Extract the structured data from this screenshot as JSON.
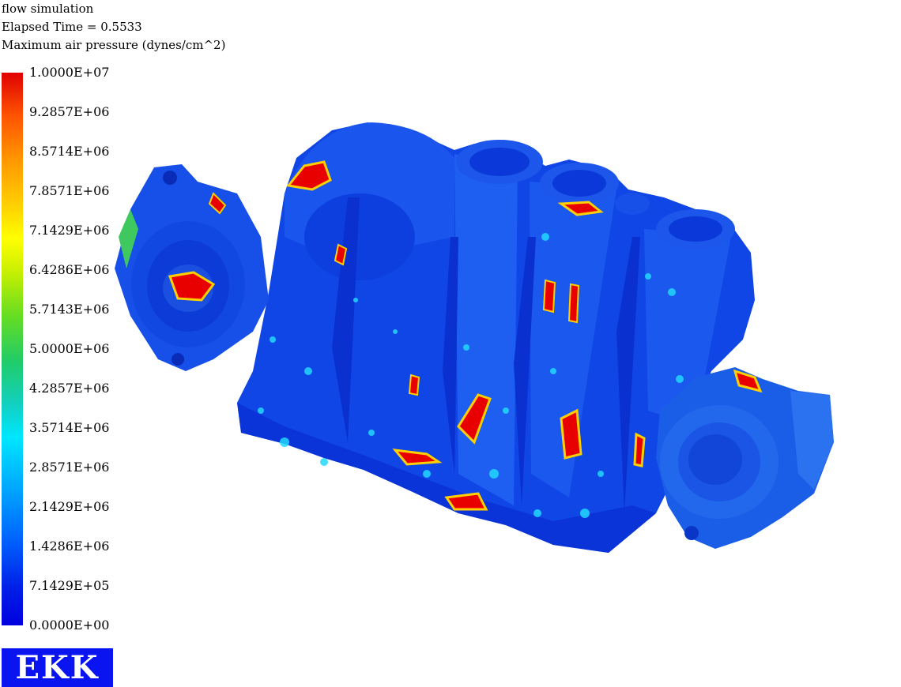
{
  "header": {
    "title": "flow simulation",
    "elapsed": "Elapsed Time = 0.5533",
    "quantity": "Maximum air pressure (dynes/cm^2)"
  },
  "legend": {
    "ticks": [
      "1.0000E+07",
      "9.2857E+06",
      "8.5714E+06",
      "7.8571E+06",
      "7.1429E+06",
      "6.4286E+06",
      "5.7143E+06",
      "5.0000E+06",
      "4.2857E+06",
      "3.5714E+06",
      "2.8571E+06",
      "2.1429E+06",
      "1.4286E+06",
      "7.1429E+05",
      "0.0000E+00"
    ],
    "colors": {
      "max": "#e00000",
      "mid": "#ffff00",
      "low": "#00e6ff",
      "min": "#0000e0"
    }
  },
  "logo": {
    "text": "EKK",
    "background": "#0a14f0"
  }
}
